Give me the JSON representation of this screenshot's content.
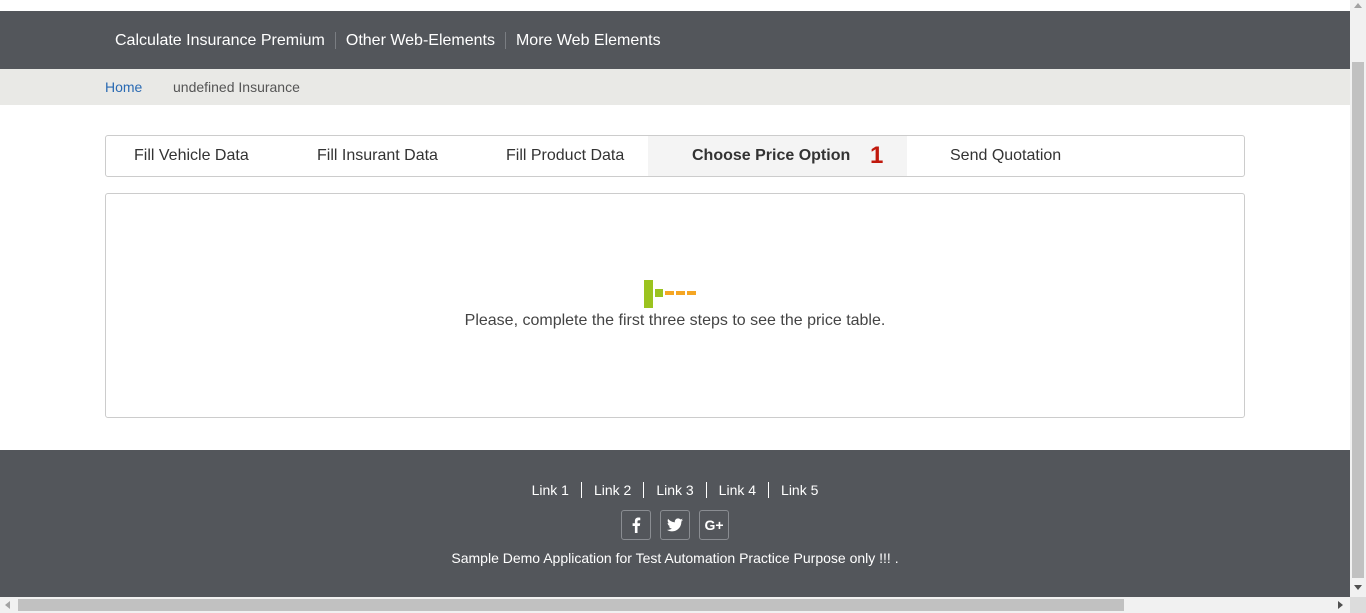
{
  "nav": {
    "items": [
      {
        "label": "Calculate Insurance Premium"
      },
      {
        "label": "Other Web-Elements"
      },
      {
        "label": "More Web Elements"
      }
    ]
  },
  "breadcrumb": {
    "home": "Home",
    "current": "undefined Insurance"
  },
  "wizard": {
    "tabs": [
      {
        "label": "Fill Vehicle Data"
      },
      {
        "label": "Fill Insurant Data"
      },
      {
        "label": "Fill Product Data"
      },
      {
        "label": "Choose Price Option",
        "active": true,
        "count": "1"
      },
      {
        "label": "Send Quotation"
      }
    ]
  },
  "content": {
    "message": "Please, complete the first three steps to see the price table.",
    "loader_icon": "loading-bars-icon"
  },
  "footer": {
    "links": [
      {
        "label": "Link 1"
      },
      {
        "label": "Link 2"
      },
      {
        "label": "Link 3"
      },
      {
        "label": "Link 4"
      },
      {
        "label": "Link 5"
      }
    ],
    "social": [
      {
        "icon": "facebook-icon",
        "glyph": "f"
      },
      {
        "icon": "twitter-icon",
        "glyph": "🐦"
      },
      {
        "icon": "google-plus-icon",
        "glyph": "G+"
      }
    ],
    "copyright": "Sample Demo Application for Test Automation Practice Purpose only !!! ."
  },
  "colors": {
    "navbar_bg": "#53565b",
    "breadcrumb_bg": "#e9e9e6",
    "link_blue": "#2a6ab3",
    "count_red": "#c0180c",
    "loader_green": "#9bc31f",
    "loader_orange": "#f5a623"
  }
}
